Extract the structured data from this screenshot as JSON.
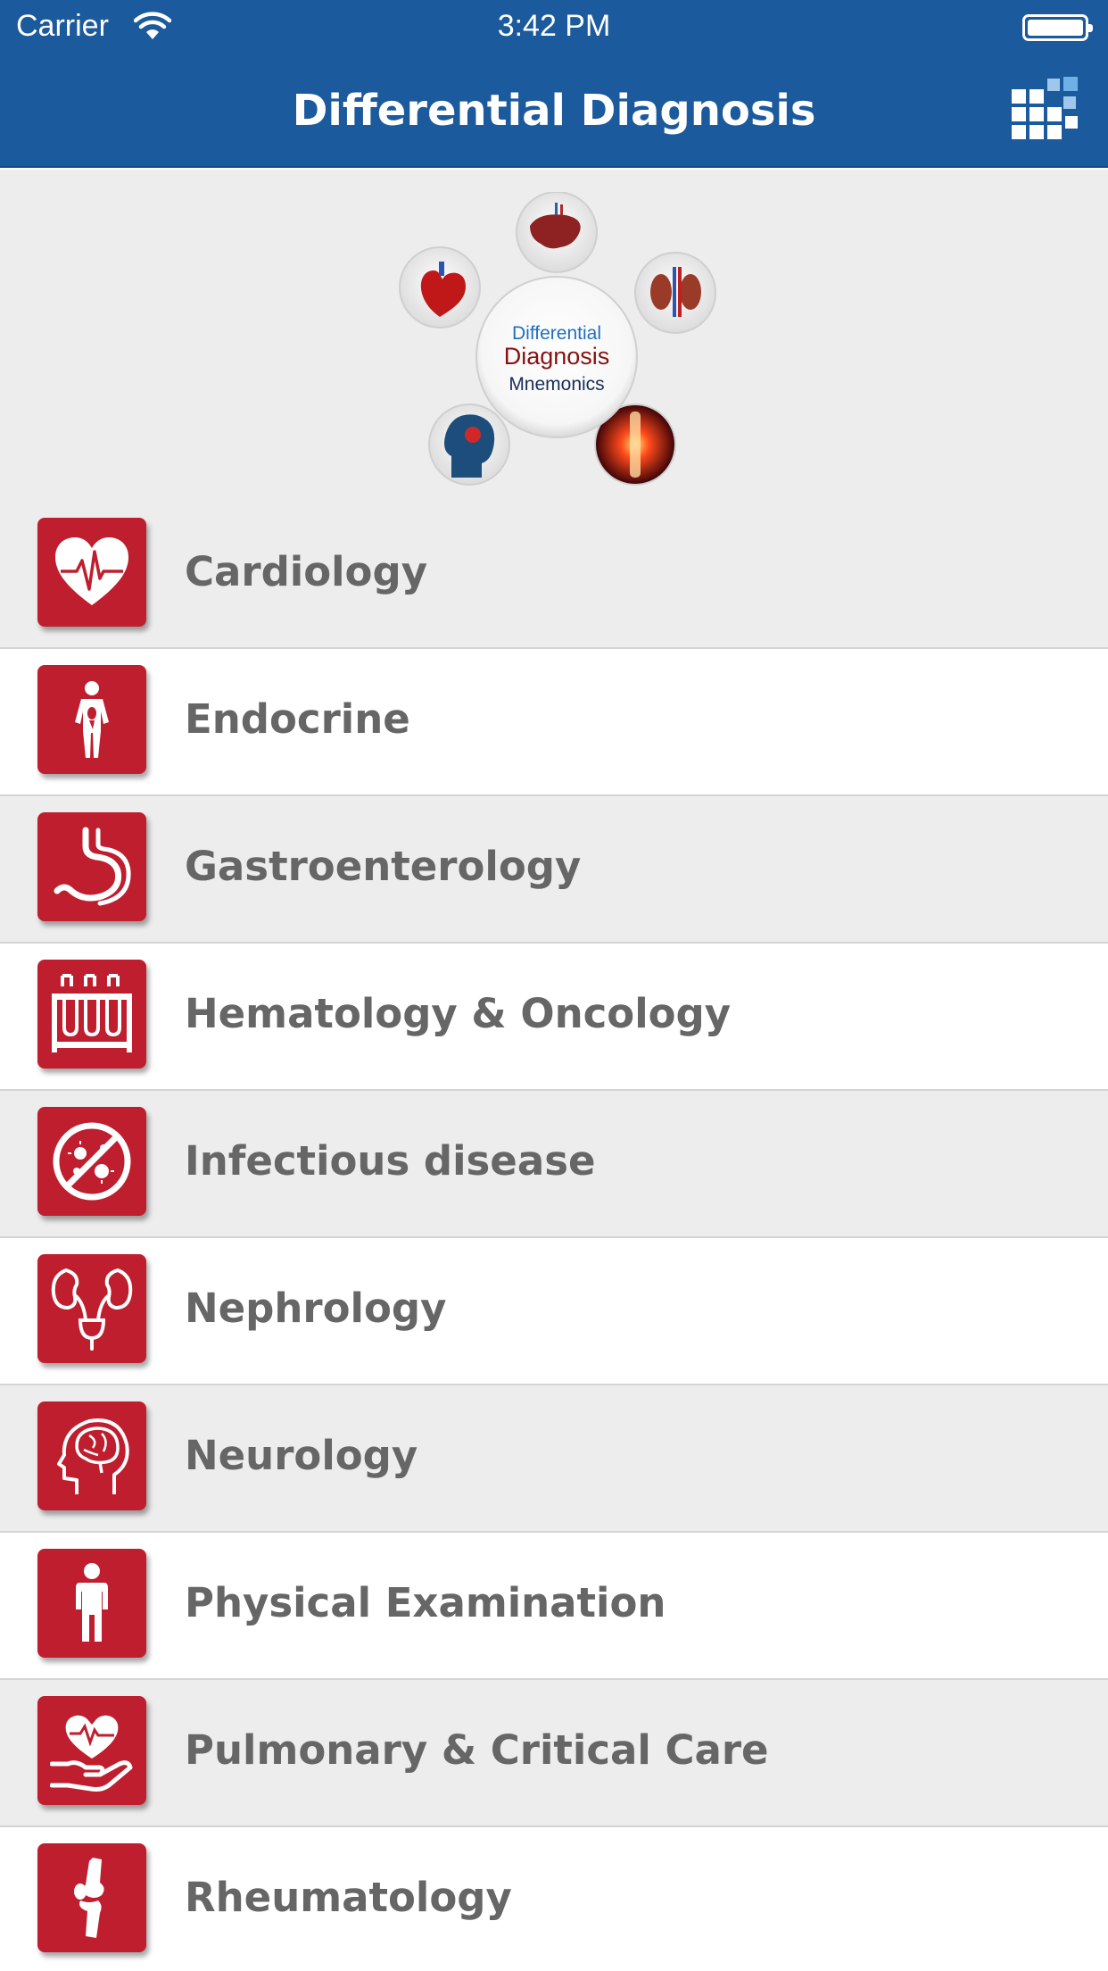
{
  "status_bar": {
    "carrier": "Carrier",
    "time": "3:42 PM"
  },
  "nav": {
    "title": "Differential Diagnosis"
  },
  "banner": {
    "line1": "Differential",
    "line2": "Diagnosis",
    "line3": "Mnemonics"
  },
  "categories": [
    {
      "label": "Cardiology",
      "icon": "heart-ecg-icon"
    },
    {
      "label": "Endocrine",
      "icon": "body-organs-icon"
    },
    {
      "label": "Gastroenterology",
      "icon": "stomach-icon"
    },
    {
      "label": "Hematology & Oncology",
      "icon": "test-tubes-icon"
    },
    {
      "label": "Infectious disease",
      "icon": "no-germs-icon"
    },
    {
      "label": "Nephrology",
      "icon": "kidneys-icon"
    },
    {
      "label": "Neurology",
      "icon": "head-brain-icon"
    },
    {
      "label": "Physical Examination",
      "icon": "person-icon"
    },
    {
      "label": "Pulmonary & Critical Care",
      "icon": "heart-in-hand-icon"
    },
    {
      "label": "Rheumatology",
      "icon": "knee-joint-icon"
    }
  ],
  "colors": {
    "header": "#1b5a9c",
    "icon_background": "#be1e2d",
    "label_text": "#666666",
    "row_alt": "#ededed"
  }
}
